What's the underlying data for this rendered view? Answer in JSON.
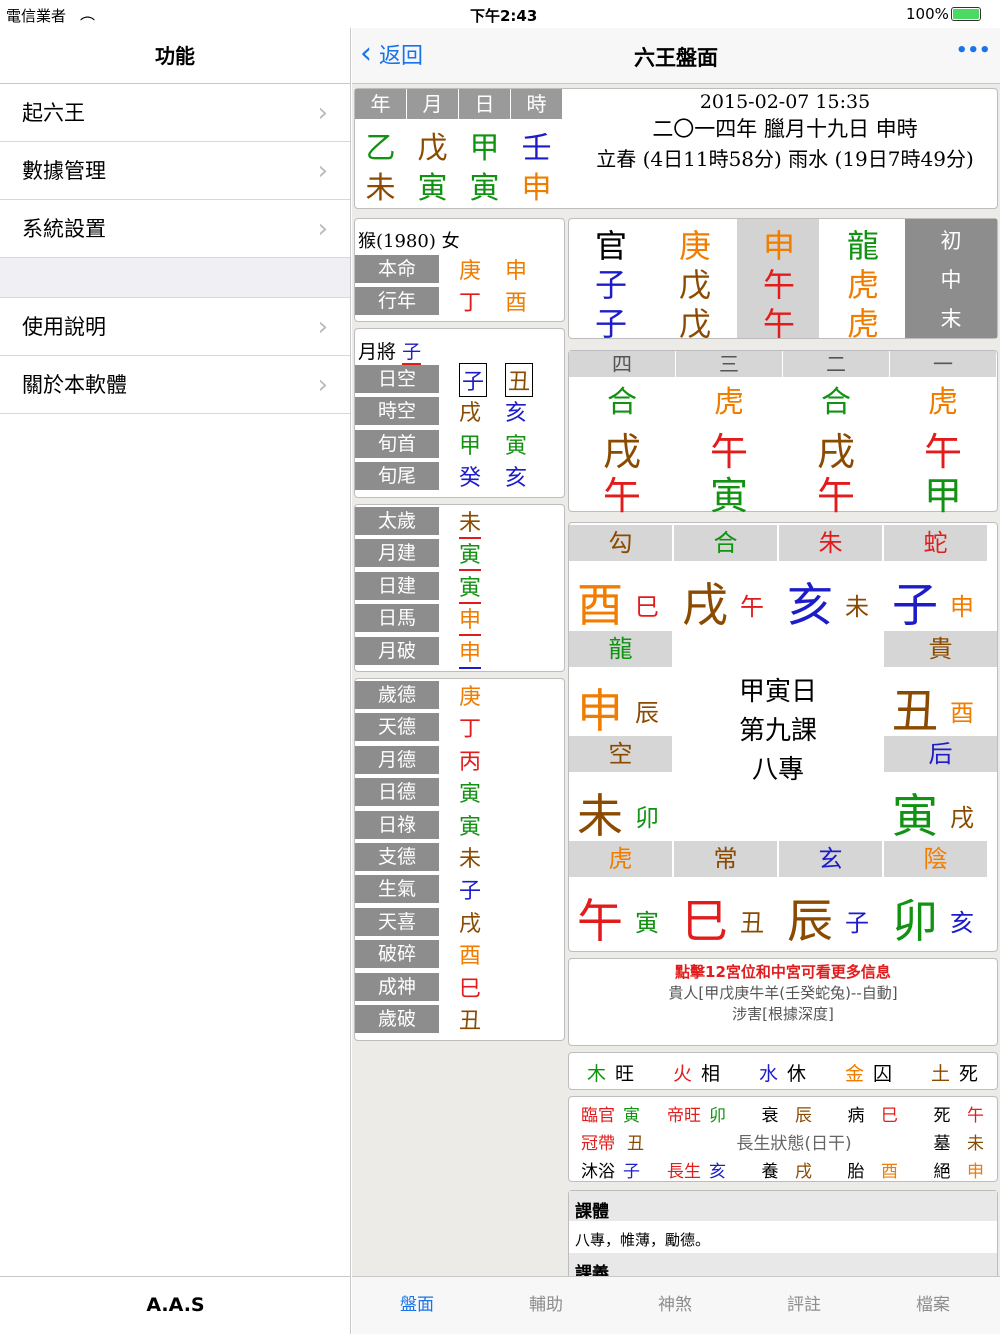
{
  "status": {
    "carrier": "電信業者",
    "time": "下午2:43",
    "battery": "100%"
  },
  "left": {
    "title": "功能",
    "items": [
      "起六王",
      "數據管理",
      "系統設置"
    ],
    "items2": [
      "使用說明",
      "關於本軟體"
    ],
    "footer": "A.A.S"
  },
  "nav": {
    "back": "返回",
    "title": "六王盤面",
    "more": "•••"
  },
  "pillars": {
    "headers": [
      "年",
      "月",
      "日",
      "時"
    ],
    "stems": [
      "乙",
      "戊",
      "甲",
      "壬"
    ],
    "branches": [
      "未",
      "寅",
      "寅",
      "申"
    ],
    "date": "2015-02-07 15:35",
    "lunar": "二〇一四年 臘月十九日 申時",
    "solar": "立春 (4日11時58分) 雨水 (19日7時49分)"
  },
  "person": {
    "info": "猴(1980) 女",
    "rows": [
      {
        "label": "本命",
        "a": "庚",
        "b": "申"
      },
      {
        "label": "行年",
        "a": "丁",
        "b": "酉"
      }
    ]
  },
  "yuejiang": {
    "label": "月將",
    "value": "子",
    "rows": [
      {
        "label": "日空",
        "a": "子",
        "b": "丑"
      },
      {
        "label": "時空",
        "a": "戌",
        "b": "亥"
      },
      {
        "label": "旬首",
        "a": "甲",
        "b": "寅"
      },
      {
        "label": "旬尾",
        "a": "癸",
        "b": "亥"
      }
    ]
  },
  "shensha1": [
    {
      "label": "太歲",
      "v": "未"
    },
    {
      "label": "月建",
      "v": "寅"
    },
    {
      "label": "日建",
      "v": "寅"
    },
    {
      "label": "日馬",
      "v": "申"
    },
    {
      "label": "月破",
      "v": "申"
    }
  ],
  "shensha2": [
    {
      "label": "歲德",
      "v": "庚"
    },
    {
      "label": "天德",
      "v": "丁"
    },
    {
      "label": "月德",
      "v": "丙"
    },
    {
      "label": "日德",
      "v": "寅"
    },
    {
      "label": "日祿",
      "v": "寅"
    },
    {
      "label": "支德",
      "v": "未"
    },
    {
      "label": "生氣",
      "v": "子"
    },
    {
      "label": "天喜",
      "v": "戌"
    },
    {
      "label": "破碎",
      "v": "酉"
    },
    {
      "label": "成神",
      "v": "巳"
    },
    {
      "label": "歲破",
      "v": "丑"
    }
  ],
  "sanchuan": {
    "cols": [
      [
        "官",
        "子",
        "子"
      ],
      [
        "庚",
        "戊",
        "戊"
      ],
      [
        "申",
        "午",
        "午"
      ],
      [
        "龍",
        "虎",
        "虎"
      ]
    ],
    "labels": [
      "初",
      "中",
      "末"
    ]
  },
  "sike": {
    "headers": [
      "四",
      "三",
      "二",
      "一"
    ],
    "cols": [
      [
        "合",
        "戌",
        "午"
      ],
      [
        "虎",
        "午",
        "寅"
      ],
      [
        "合",
        "戌",
        "午"
      ],
      [
        "虎",
        "午",
        "甲"
      ]
    ]
  },
  "board": {
    "top": [
      {
        "g": "勾",
        "b": "酉",
        "s": "巳"
      },
      {
        "g": "合",
        "b": "戌",
        "s": "午"
      },
      {
        "g": "朱",
        "b": "亥",
        "s": "未"
      },
      {
        "g": "蛇",
        "b": "子",
        "s": "申"
      }
    ],
    "left": [
      {
        "g": "龍",
        "b": "申",
        "s": "辰"
      },
      {
        "g": "空",
        "b": "未",
        "s": "卯"
      }
    ],
    "right": [
      {
        "g": "貴",
        "b": "丑",
        "s": "酉"
      },
      {
        "g": "后",
        "b": "寅",
        "s": "戌"
      }
    ],
    "bottom": [
      {
        "g": "虎",
        "b": "午",
        "s": "寅"
      },
      {
        "g": "常",
        "b": "巳",
        "s": "丑"
      },
      {
        "g": "玄",
        "b": "辰",
        "s": "子"
      },
      {
        "g": "陰",
        "b": "卯",
        "s": "亥"
      }
    ],
    "center": [
      "甲寅日",
      "第九課",
      "八專"
    ]
  },
  "info": {
    "line1": "點擊12宮位和中宮可看更多信息",
    "line2": "貴人[甲戊庚牛羊(壬癸蛇兔)--自動]",
    "line3": "涉害[根據深度]"
  },
  "wuxing": [
    {
      "a": "木",
      "b": "旺"
    },
    {
      "a": "火",
      "b": "相"
    },
    {
      "a": "水",
      "b": "休"
    },
    {
      "a": "金",
      "b": "囚"
    },
    {
      "a": "土",
      "b": "死"
    }
  ],
  "changsheng": {
    "row1": [
      {
        "a": "臨官",
        "b": "寅"
      },
      {
        "a": "帝旺",
        "b": "卯"
      },
      {
        "a": "衰",
        "b": "辰"
      },
      {
        "a": "病",
        "b": "巳"
      },
      {
        "a": "死",
        "b": "午"
      }
    ],
    "row2a": {
      "a": "冠帶",
      "b": "丑"
    },
    "row2mid": "長生狀態(日干)",
    "row2b": {
      "a": "墓",
      "b": "未"
    },
    "row3": [
      {
        "a": "沐浴",
        "b": "子"
      },
      {
        "a": "長生",
        "b": "亥"
      },
      {
        "a": "養",
        "b": "戌"
      },
      {
        "a": "胎",
        "b": "酉"
      },
      {
        "a": "絕",
        "b": "申"
      }
    ]
  },
  "keti": {
    "title": "課體",
    "text": "八專，帷薄，勵德。",
    "title2": "課義"
  },
  "tabs": [
    "盤面",
    "輔助",
    "神煞",
    "評註",
    "檔案"
  ]
}
